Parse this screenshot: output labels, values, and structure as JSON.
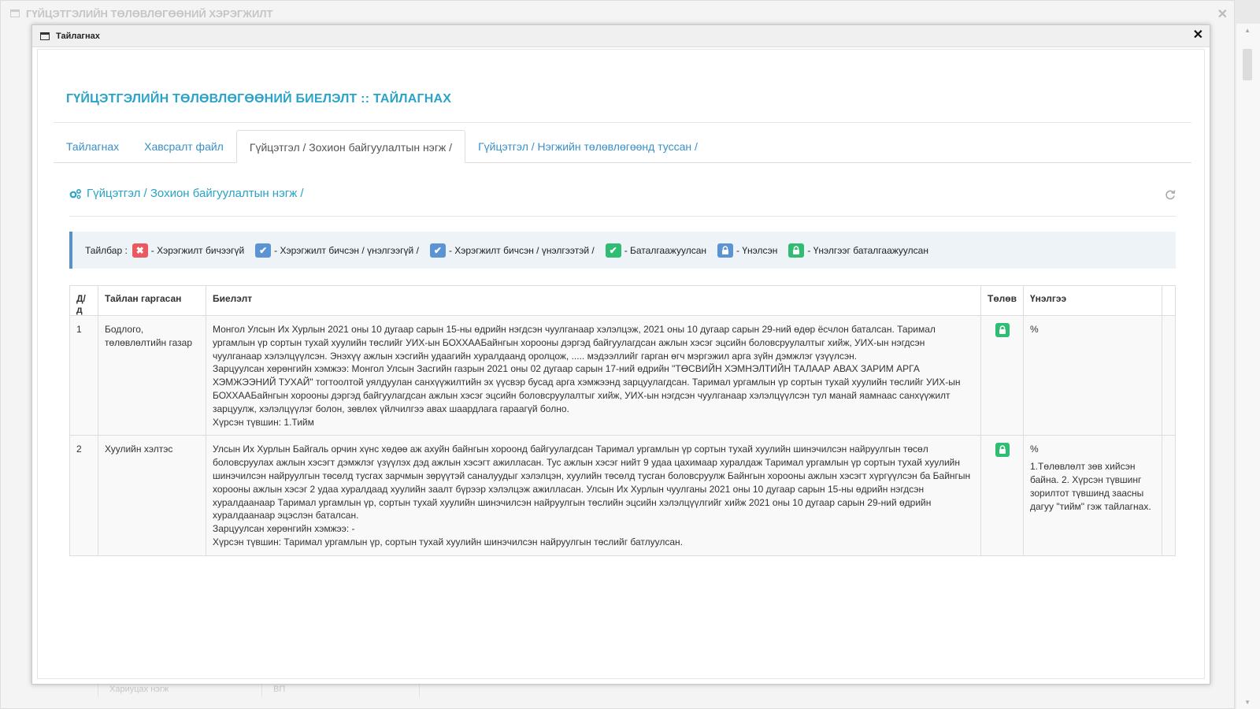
{
  "background_window": {
    "title": "ГҮЙЦЭТГЭЛИЙН ТӨЛӨВЛӨГӨӨНИЙ ХЭРЭГЖИЛТ",
    "footer_cells": [
      "Хариуцах нэгж",
      "ВП"
    ]
  },
  "modal": {
    "title": "Тайлагнах",
    "heading": "ГҮЙЦЭТГЭЛИЙН ТӨЛӨВЛӨГӨӨНИЙ БИЕЛЭЛТ :: ТАЙЛАГНАХ",
    "tabs": [
      {
        "label": "Тайлагнах",
        "active": false
      },
      {
        "label": "Хавсралт файл",
        "active": false
      },
      {
        "label": "Гүйцэтгэл / Зохион байгуулалтын нэгж /",
        "active": true
      },
      {
        "label": "Гүйцэтгэл / Нэгжийн төлөвлөгөөнд туссан /",
        "active": false
      }
    ],
    "section_title": "Гүйцэтгэл / Зохион байгуулалтын нэгж /",
    "legend": {
      "label": "Тайлбар :",
      "items": [
        {
          "icon": "times-icon",
          "color": "#e9595f",
          "text": "- Хэрэгжилт бичээгүй"
        },
        {
          "icon": "check-icon",
          "color": "#5b93d3",
          "text": "- Хэрэгжилт бичсэн / үнэлгээгүй /"
        },
        {
          "icon": "check-icon",
          "color": "#5b93d3",
          "text": "- Хэрэгжилт бичсэн / үнэлгээтэй /"
        },
        {
          "icon": "check-icon",
          "color": "#2ebd73",
          "text": "- Баталгаажуулсан"
        },
        {
          "icon": "lock-icon",
          "color": "#5b93d3",
          "text": "- Үнэлсэн"
        },
        {
          "icon": "lock-icon",
          "color": "#2ebd73",
          "text": "- Үнэлгээг баталгаажуулсан"
        }
      ]
    },
    "table": {
      "headers": [
        "Д/д",
        "Тайлан гаргасан",
        "Биелэлт",
        "Төлөв",
        "Үнэлгээ",
        ""
      ],
      "rows": [
        {
          "num": "1",
          "giver": "Бодлого, төлөвлөлтийн газар",
          "progress": [
            "Монгол Улсын Их Хурлын 2021 оны 10 дугаар сарын 15-ны өдрийн нэгдсэн чуулганаар хэлэлцэж, 2021 оны 10 дугаар сарын 29-ний өдөр ёсчлон баталсан. Таримал ургамлын үр сортын тухай хуулийн төслийг УИХ-ын БОХХААБайнгын хорооны дэргэд байгуулагдсан ажлын хэсэг эцсийн боловсруулалтыг хийж, УИХ-ын нэгдсэн чуулганаар хэлэлцүүлсэн. Энэхүү ажлын хэсгийн удаагийн хуралдаанд оролцож, ..... мэдээллийг гарган өгч мэргэжил арга зүйн дэмжлэг үзүүлсэн.",
            "Зарцуулсан хөрөнгийн хэмжээ: Монгол Улсын Засгийн газрын 2021 оны 02 дугаар сарын 17-ний өдрийн \"ТӨСВИЙН ХЭМНЭЛТИЙН ТАЛААР АВАХ ЗАРИМ АРГА ХЭМЖЭЭНИЙ ТУХАЙ\" тогтоолтой уялдуулан санхүүжилтийн эх үүсвэр бусад арга хэмжээнд зарцуулагдсан. Таримал ургамлын үр сортын тухай хуулийн төслийг УИХ-ын БОХХААБайнгын хорооны дэргэд байгуулагдсан ажлын хэсэг эцсийн боловсруулалтыг хийж, УИХ-ын нэгдсэн чуулганаар хэлэлцүүлсэн тул манай яамнаас санхүүжилт зарцуулж, хэлэлцүүлэг болон, зөвлөх үйлчилгээ авах шаардлага гараагүй болно.",
            "Хүрсэн түвшин: 1.Тийм"
          ],
          "status_icon": "lock-icon",
          "eval_percent": "%",
          "eval_note": ""
        },
        {
          "num": "2",
          "giver": "Хуулийн хэлтэс",
          "progress": [
            "Улсын Их Хурлын Байгаль орчин хүнс хөдөө аж ахуйн байнгын хороонд байгуулагдсан Таримал ургамлын үр сортын тухай хуулийн шинэчилсэн найруулгын төсөл боловсруулах ажлын хэсэгт дэмжлэг үзүүлэх дэд ажлын хэсэгт ажилласан. Тус ажлын хэсэг нийт 9 удаа цахимаар хуралдаж Таримал ургамлын үр сортын тухай хуулийн шинэчилсэн найруулгын төсөлд тусгах зарчмын зөрүүтэй саналуудыг хэлэлцэн, хуулийн төсөлд тусган боловсруулж Байнгын хорооны ажлын хэсэгт хүргүүлсэн ба Байнгын хорооны ажлын хэсэг 2 удаа хуралдаад хуулийн заалт бүрээр хэлэлцэж ажилласан. Улсын Их Хурлын чуулганы 2021 оны 10 дугаар сарын 15-ны өдрийн нэгдсэн хуралдаанаар Таримал ургамлын үр, сортын тухай хуулийн шинэчилсэн найруулгын төслийн эцсийн хэлэлцүүлгийг хийж 2021 оны 10 дугаар сарын 29-ний өдрийн хуралдаанаар эцэслэн баталсан.",
            "Зарцуулсан хөрөнгийн хэмжээ: -",
            "Хүрсэн түвшин: Таримал ургамлын үр, сортын тухай хуулийн шинэчилсэн найруулгын төслийг батлуулсан."
          ],
          "status_icon": "lock-icon",
          "eval_percent": "%",
          "eval_note": "1.Төлөвлөлт зөв хийсэн байна. 2. Хүрсэн түвшинг зорилтот түвшинд заасны дагуу \"тийм\" гэж тайлагнах."
        }
      ]
    }
  }
}
